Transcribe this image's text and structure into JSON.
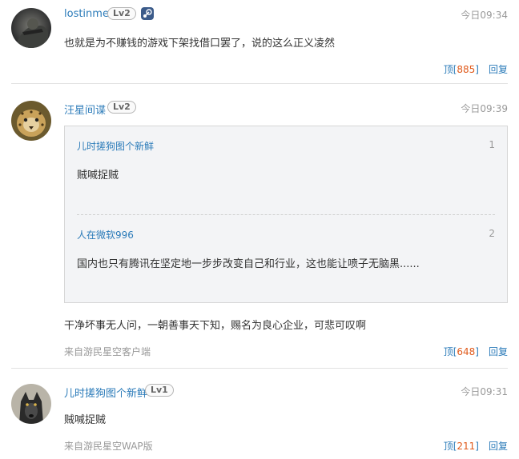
{
  "comments": [
    {
      "user": "lostinme",
      "level": "Lv2",
      "time": "今日09:34",
      "text": "也就是为不赚钱的游戏下架找借口罢了，说的这么正义凌然",
      "up_prefix": "顶[",
      "up_count": "885",
      "up_suffix": "]",
      "reply": "回复",
      "badge_icon": "steam-icon"
    },
    {
      "user": "汪星间谍",
      "level": "Lv2",
      "time": "今日09:39",
      "quotes": [
        {
          "user": "儿时搓狗图个新鲜",
          "floor": "1",
          "text": "贼喊捉贼"
        },
        {
          "user": "人在微软996",
          "floor": "2",
          "text": "国内也只有腾讯在坚定地一步步改变自己和行业，这也能让喷子无脑黑......"
        }
      ],
      "text": "干净坏事无人问，一朝善事天下知，赐名为良心企业，可悲可叹啊",
      "source": "来自游民星空客户端",
      "up_prefix": "顶[",
      "up_count": "648",
      "up_suffix": "]",
      "reply": "回复"
    },
    {
      "user": "儿时搓狗图个新鲜",
      "level": "Lv1",
      "time": "今日09:31",
      "text": "贼喊捉贼",
      "source": "来自游民星空WAP版",
      "up_prefix": "顶[",
      "up_count": "211",
      "up_suffix": "]",
      "reply": "回复"
    }
  ],
  "colors": {
    "link": "#2b7bb9",
    "count": "#e05a1b",
    "muted": "#999999"
  }
}
